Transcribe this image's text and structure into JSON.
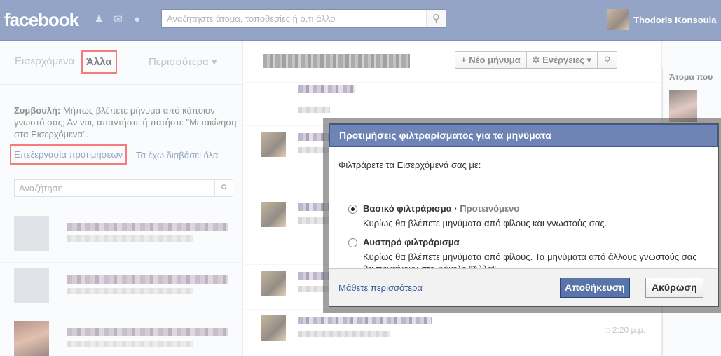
{
  "topbar": {
    "logo": "facebook",
    "icons": [
      "friend-requests-icon",
      "messages-icon",
      "notifications-globe-icon"
    ],
    "search_placeholder": "Αναζητήστε άτομα, τοποθεσίες ή ό,τι άλλο",
    "user_name": "Thodoris Konsoula"
  },
  "left": {
    "tabs": {
      "inbox": "Εισερχόμενα",
      "other": "Άλλα",
      "more": "Περισσότερα ▾"
    },
    "tip_label": "Συμβουλή:",
    "tip_text": " Μήπως βλέπετε μήνυμα από κάποιον γνωστό σας; Αν ναι, απαντήστε ή πατήστε \"Μετακίνηση στα Εισερχόμενα\".",
    "edit_prefs": "Επεξεργασία προτιμήσεων",
    "mark_read": "Τα έχω διαβάσει όλα",
    "search_placeholder": "Αναζήτηση"
  },
  "middle": {
    "buttons": {
      "new_message": "+ Νέο μήνυμα",
      "actions": "✲ Ενέργειες ▾"
    },
    "time": "2:20 μ.μ."
  },
  "right": {
    "title": "Άτομα που"
  },
  "dialog": {
    "title": "Προτιμήσεις φιλτραρίσματος για τα μηνύματα",
    "label": "Φιλτράρετε τα Εισερχόμενά σας με:",
    "option1_title": "Βασικό φιλτράρισμα",
    "option1_separator": " · ",
    "option1_recommended": "Προτεινόμενο",
    "option1_desc": "Κυρίως θα βλέπετε μηνύματα από φίλους και γνωστούς σας.",
    "option2_title": "Αυστηρό φιλτράρισμα",
    "option2_desc": "Κυρίως θα βλέπετε μηνύματα από φίλους. Τα μηνύματα από άλλους γνωστούς σας θα πηγαίνουν στο φάκελο \"Άλλα\".",
    "learn_more": "Μάθετε περισσότερα",
    "save": "Αποθήκευση",
    "cancel": "Ακύρωση",
    "selected_option": "basic"
  }
}
